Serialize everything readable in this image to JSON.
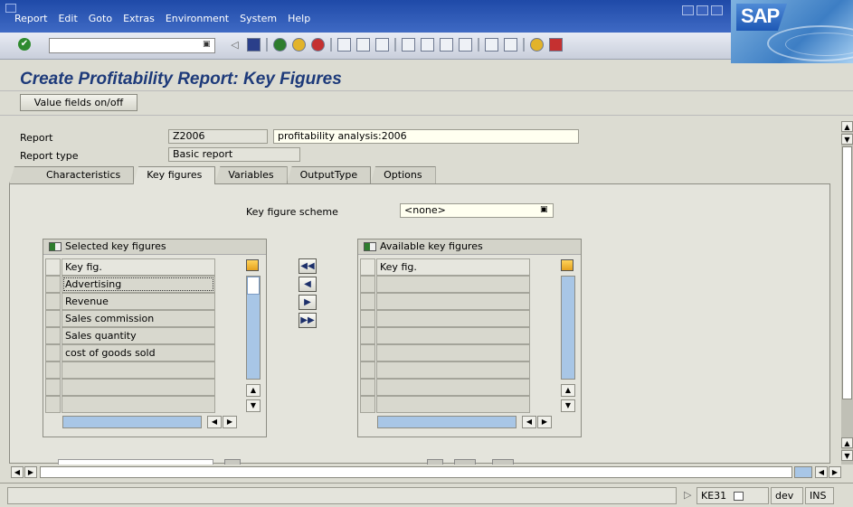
{
  "menu": {
    "items": [
      "Report",
      "Edit",
      "Goto",
      "Extras",
      "Environment",
      "System",
      "Help"
    ]
  },
  "brand": {
    "logo_text": "SAP"
  },
  "title": "Create Profitability Report: Key Figures",
  "app_toolbar": {
    "value_fields_label": "Value fields on/off"
  },
  "header": {
    "report_label": "Report",
    "report_code": "Z2006",
    "report_desc": "profitability analysis:2006",
    "report_type_label": "Report type",
    "report_type_value": "Basic report"
  },
  "tabs": [
    {
      "label": "Characteristics",
      "active": false
    },
    {
      "label": "Key figures",
      "active": true
    },
    {
      "label": "Variables",
      "active": false
    },
    {
      "label": "OutputType",
      "active": false
    },
    {
      "label": "Options",
      "active": false
    }
  ],
  "scheme": {
    "label": "Key figure scheme",
    "value": "<none>"
  },
  "selected": {
    "title": "Selected key figures",
    "column": "Key fig.",
    "rows": [
      "Advertising",
      "Revenue",
      "Sales commission",
      "Sales quantity",
      "cost of goods sold",
      "",
      "",
      ""
    ]
  },
  "available": {
    "title": "Available key figures",
    "column": "Key fig.",
    "rows": [
      "",
      "",
      "",
      "",
      "",
      "",
      "",
      ""
    ]
  },
  "move_buttons": [
    "◀◀",
    "◀",
    "▶",
    "▶▶"
  ],
  "status": {
    "tcode": "KE31",
    "server": "dev",
    "mode": "INS"
  }
}
